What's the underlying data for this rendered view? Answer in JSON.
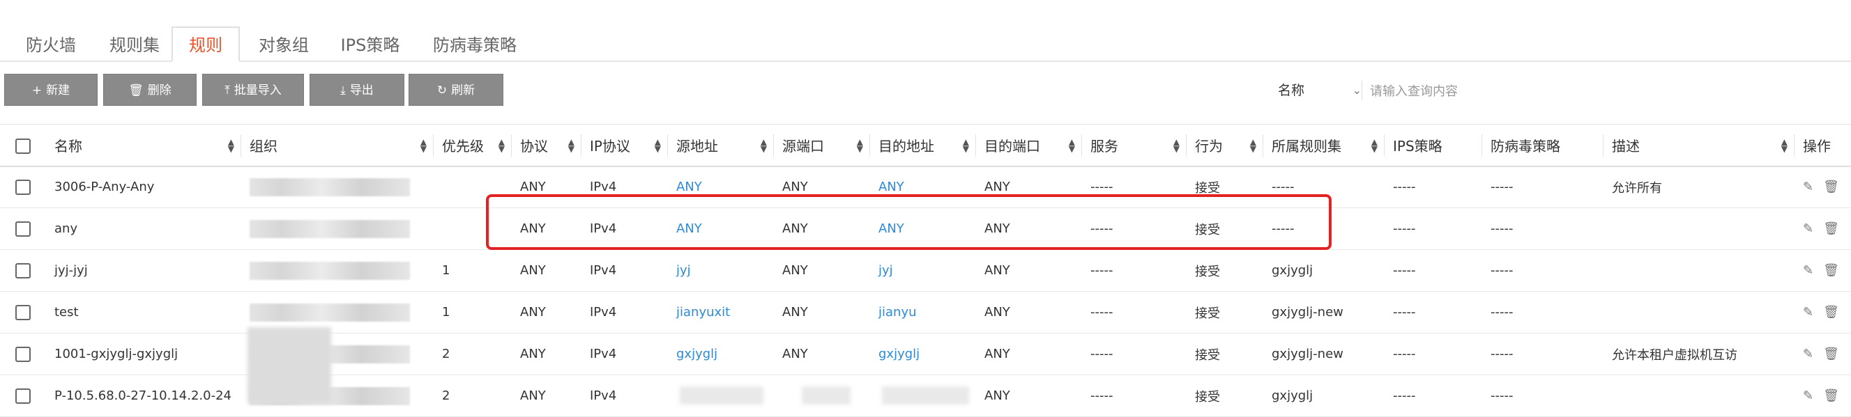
{
  "tabs": [
    {
      "label": "防火墙",
      "active": false
    },
    {
      "label": "规则集",
      "active": false
    },
    {
      "label": "规则",
      "active": true
    },
    {
      "label": "对象组",
      "active": false
    },
    {
      "label": "IPS策略",
      "active": false
    },
    {
      "label": "防病毒策略",
      "active": false
    }
  ],
  "toolbar": {
    "new_label": "新建",
    "delete_label": "删除",
    "import_label": "批量导入",
    "export_label": "导出",
    "refresh_label": "刷新"
  },
  "search": {
    "field": "名称",
    "placeholder": "请输入查询内容"
  },
  "table": {
    "columns": [
      "名称",
      "组织",
      "优先级",
      "协议",
      "IP协议",
      "源地址",
      "源端口",
      "目的地址",
      "目的端口",
      "服务",
      "行为",
      "所属规则集",
      "IPS策略",
      "防病毒策略",
      "描述",
      "操作"
    ],
    "rows": [
      {
        "name": "3006-P-Any-Any",
        "priority": "",
        "protocol": "ANY",
        "ip_protocol": "IPv4",
        "src_addr": "ANY",
        "src_port": "ANY",
        "dst_addr": "ANY",
        "dst_port": "ANY",
        "service": "-----",
        "action": "接受",
        "ruleset": "-----",
        "ips": "-----",
        "av": "-----",
        "desc": "允许所有"
      },
      {
        "name": "any",
        "priority": "",
        "protocol": "ANY",
        "ip_protocol": "IPv4",
        "src_addr": "ANY",
        "src_port": "ANY",
        "dst_addr": "ANY",
        "dst_port": "ANY",
        "service": "-----",
        "action": "接受",
        "ruleset": "-----",
        "ips": "-----",
        "av": "-----",
        "desc": ""
      },
      {
        "name": "jyj-jyj",
        "priority": "1",
        "protocol": "ANY",
        "ip_protocol": "IPv4",
        "src_addr": "jyj",
        "src_port": "ANY",
        "dst_addr": "jyj",
        "dst_port": "ANY",
        "service": "-----",
        "action": "接受",
        "ruleset": "gxjyglj",
        "ips": "-----",
        "av": "-----",
        "desc": ""
      },
      {
        "name": "test",
        "priority": "1",
        "protocol": "ANY",
        "ip_protocol": "IPv4",
        "src_addr": "jianyuxit",
        "src_port": "ANY",
        "dst_addr": "jianyu",
        "dst_port": "ANY",
        "service": "-----",
        "action": "接受",
        "ruleset": "gxjyglj-new",
        "ips": "-----",
        "av": "-----",
        "desc": ""
      },
      {
        "name": "1001-gxjyglj-gxjyglj",
        "priority": "2",
        "protocol": "ANY",
        "ip_protocol": "IPv4",
        "src_addr": "gxjyglj",
        "src_port": "ANY",
        "dst_addr": "gxjyglj",
        "dst_port": "ANY",
        "service": "-----",
        "action": "接受",
        "ruleset": "gxjyglj-new",
        "ips": "-----",
        "av": "-----",
        "desc": "允许本租户虚拟机互访"
      },
      {
        "name": "P-10.5.68.0-27-10.14.2.0-24",
        "priority": "2",
        "protocol": "ANY",
        "ip_protocol": "IPv4",
        "src_addr": "",
        "src_port": "",
        "dst_addr": "",
        "dst_port": "ANY",
        "service": "-----",
        "action": "接受",
        "ruleset": "gxjyglj",
        "ips": "-----",
        "av": "-----",
        "desc": ""
      }
    ]
  },
  "colors": {
    "active_tab": "#e8532b",
    "button_bg": "#8a8a8a",
    "link": "#2d8ad8",
    "highlight_box": "#e42222"
  },
  "icons": [
    "plus-icon",
    "trash-icon",
    "upload-icon",
    "download-icon",
    "refresh-icon",
    "sort-icon",
    "edit-icon",
    "delete-icon",
    "chevron-down-icon"
  ]
}
